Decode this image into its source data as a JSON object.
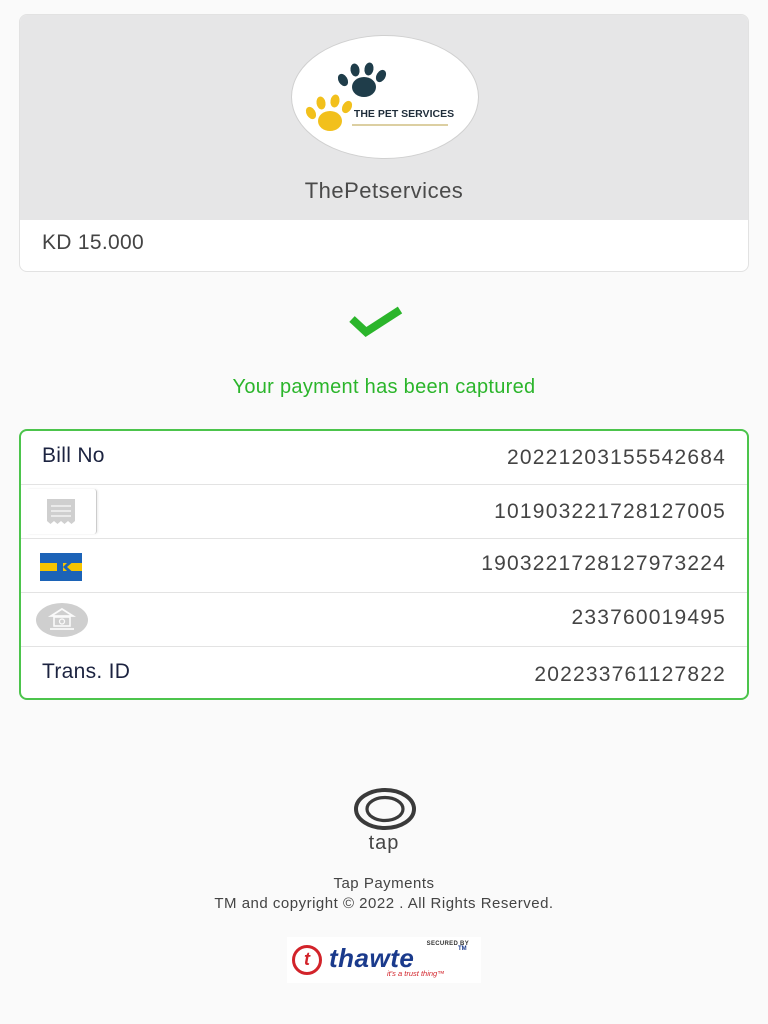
{
  "merchant": {
    "logo_text": "THE PET SERVICES",
    "name": "ThePetservices",
    "amount": "KD 15.000"
  },
  "status": {
    "message": "Your payment has been captured",
    "icon": "check-icon",
    "color": "#2bb52b"
  },
  "details": [
    {
      "label": "Bill No",
      "icon": null,
      "value": "20221203155542684"
    },
    {
      "label": null,
      "icon": "receipt-icon",
      "value": "101903221728127005"
    },
    {
      "label": null,
      "icon": "knet-icon",
      "value": "190322172812797322​4"
    },
    {
      "label": null,
      "icon": "bank-icon",
      "value": "233760019495"
    },
    {
      "label": "Trans. ID",
      "icon": null,
      "value": "202233761127822"
    }
  ],
  "footer": {
    "brand_word": "tap",
    "company": "Tap Payments",
    "copyright": "TM and copyright © 2022 . All Rights Reserved."
  },
  "seal": {
    "secured_by": "SECURED BY",
    "brand": "thawte",
    "tm": "TM",
    "tagline": "it's a trust thing™"
  }
}
